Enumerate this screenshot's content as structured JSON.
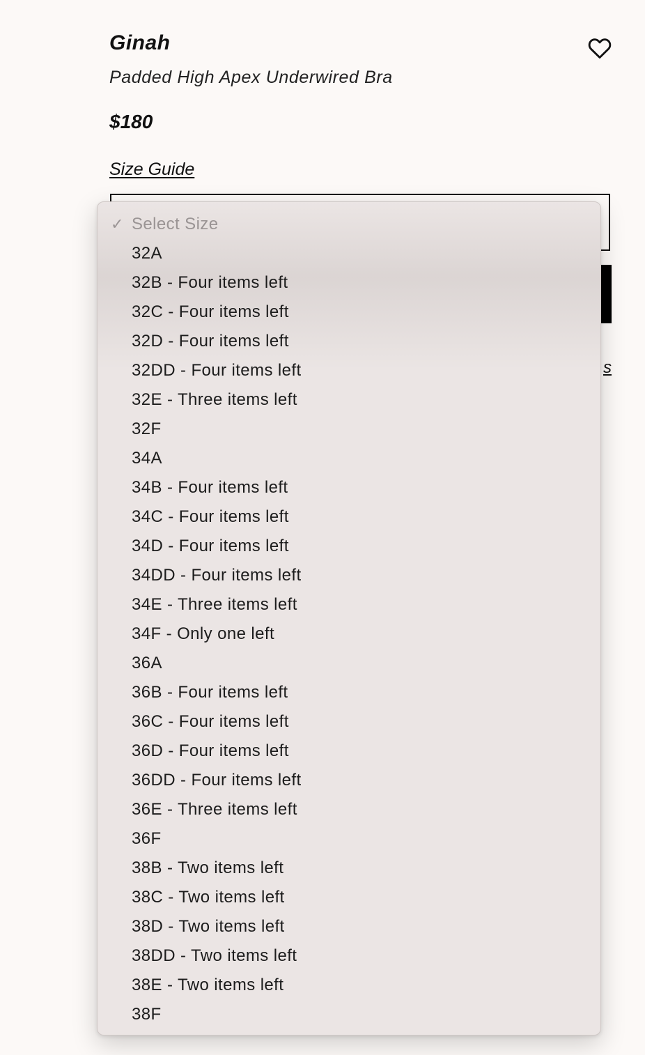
{
  "product": {
    "brand": "Ginah",
    "name": "Padded High Apex Underwired Bra",
    "price": "$180",
    "size_guide_label": "Size Guide",
    "obscured_link_fragment": "s"
  },
  "icons": {
    "wishlist": "heart-icon",
    "selected_marker": "checkmark-icon"
  },
  "colors": {
    "page_background": "#fcf9f7",
    "dropdown_background": "#ebe5e4",
    "primary_button": "#000000",
    "text": "#111111",
    "placeholder_text": "#9a9494"
  },
  "size_dropdown": {
    "selected": "Select Size",
    "check_glyph": "✓",
    "options": [
      "Select Size",
      "32A",
      "32B - Four items left",
      "32C - Four items left",
      "32D - Four items left",
      "32DD - Four items left",
      "32E - Three items left",
      "32F",
      "34A",
      "34B - Four items left",
      "34C - Four items left",
      "34D - Four items left",
      "34DD - Four items left",
      "34E - Three items left",
      "34F - Only one left",
      "36A",
      "36B - Four items left",
      "36C - Four items left",
      "36D - Four items left",
      "36DD - Four items left",
      "36E - Three items left",
      "36F",
      "38B - Two items left",
      "38C - Two items left",
      "38D - Two items left",
      "38DD - Two items left",
      "38E - Two items left",
      "38F"
    ]
  }
}
